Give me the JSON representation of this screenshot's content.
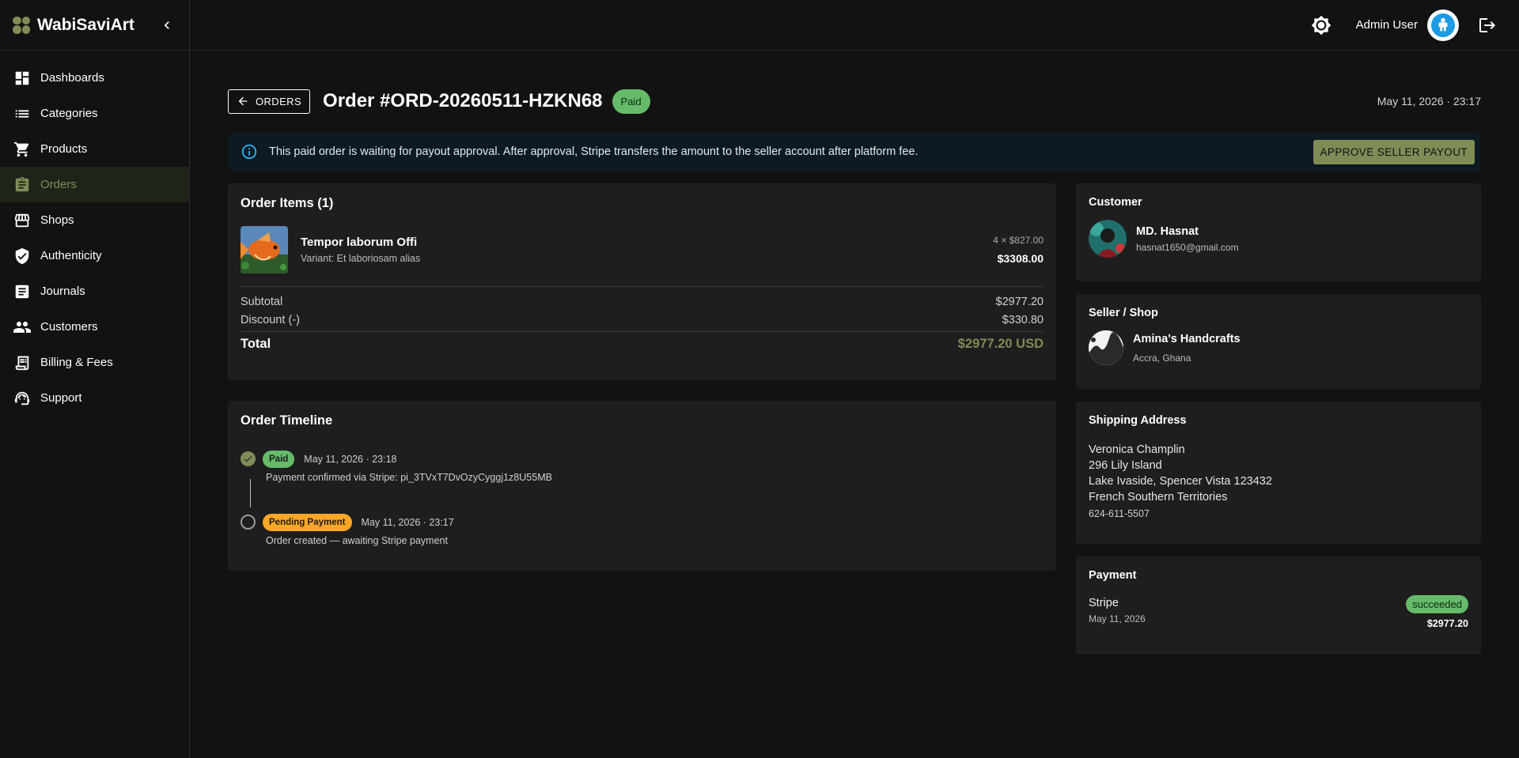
{
  "brand": {
    "name": "WabiSaviArt"
  },
  "sidebar": {
    "items": [
      {
        "label": "Dashboards",
        "icon": "dashboard-icon"
      },
      {
        "label": "Categories",
        "icon": "list-icon"
      },
      {
        "label": "Products",
        "icon": "cart-icon"
      },
      {
        "label": "Orders",
        "icon": "clipboard-icon",
        "active": true
      },
      {
        "label": "Shops",
        "icon": "store-icon"
      },
      {
        "label": "Authenticity",
        "icon": "shield-check-icon"
      },
      {
        "label": "Journals",
        "icon": "article-icon"
      },
      {
        "label": "Customers",
        "icon": "people-icon"
      },
      {
        "label": "Billing & Fees",
        "icon": "receipt-icon"
      },
      {
        "label": "Support",
        "icon": "support-agent-icon"
      }
    ]
  },
  "topbar": {
    "username": "Admin User"
  },
  "header": {
    "back_label": "ORDERS",
    "title": "Order #ORD-20260511-HZKN68",
    "status": "Paid",
    "date": "May 11, 2026 · 23:17"
  },
  "banner": {
    "text": "This paid order is waiting for payout approval. After approval, Stripe transfers the amount to the seller account after platform fee.",
    "button": "APPROVE SELLER PAYOUT"
  },
  "order_items": {
    "title": "Order Items (1)",
    "items": [
      {
        "name": "Tempor laborum Offi",
        "variant": "Variant: Et laboriosam alias",
        "qty_price": "4 × $827.00",
        "line_total": "$3308.00"
      }
    ],
    "subtotal_label": "Subtotal",
    "subtotal": "$2977.20",
    "discount_label": "Discount (-)",
    "discount": "$330.80",
    "total_label": "Total",
    "total": "$2977.20 USD"
  },
  "timeline": {
    "title": "Order Timeline",
    "events": [
      {
        "status": "Paid",
        "date": "May 11, 2026 · 23:18",
        "description": "Payment confirmed via Stripe: pi_3TVxT7DvOzyCyggj1z8U55MB"
      },
      {
        "status": "Pending Payment",
        "date": "May 11, 2026 · 23:17",
        "description": "Order created — awaiting Stripe payment"
      }
    ]
  },
  "customer": {
    "title": "Customer",
    "name": "MD. Hasnat",
    "email": "hasnat1650@gmail.com"
  },
  "seller": {
    "title": "Seller / Shop",
    "name": "Amina's Handcrafts",
    "location": "Accra, Ghana"
  },
  "shipping": {
    "title": "Shipping Address",
    "lines": [
      "Veronica Champlin",
      "296 Lily Island",
      "Lake Ivaside, Spencer Vista 123432",
      "French Southern Territories"
    ],
    "phone": "624-611-5507"
  },
  "payment": {
    "title": "Payment",
    "method": "Stripe",
    "date": "May 11, 2026",
    "status": "succeeded",
    "amount": "$2977.20"
  },
  "colors": {
    "accent": "#7f8c56",
    "success": "#66bb6a",
    "warning": "#ffa726",
    "info": "#29b6f6",
    "background": "#121212",
    "card": "#1e1e1e"
  }
}
